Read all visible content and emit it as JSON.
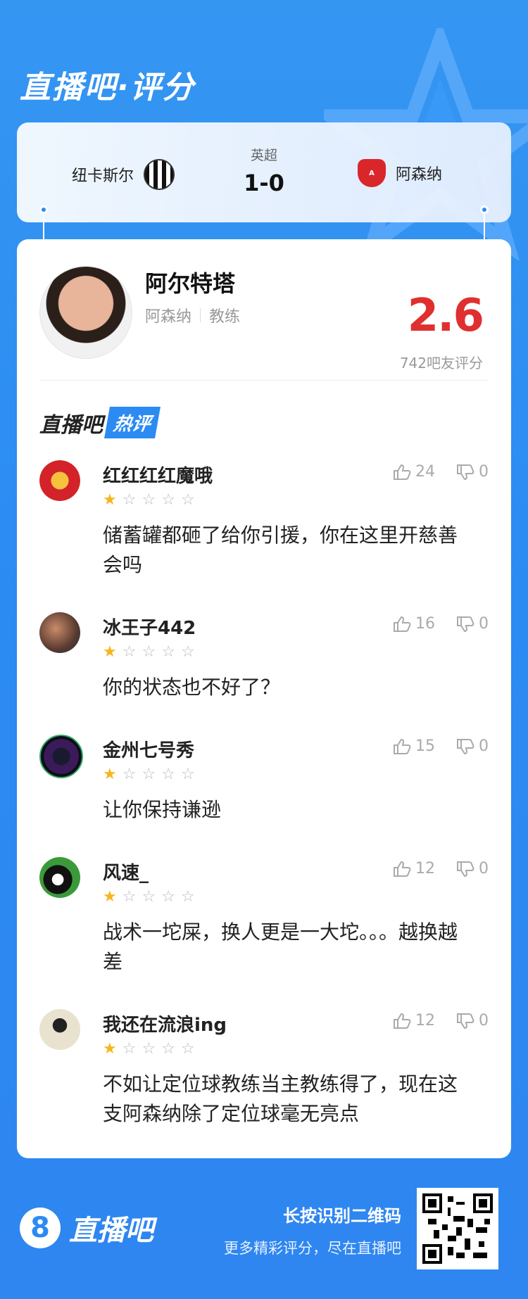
{
  "header": {
    "title": "直播吧·评分"
  },
  "match": {
    "league": "英超",
    "score": "1-0",
    "home_team": "纽卡斯尔",
    "away_team": "阿森纳"
  },
  "coach": {
    "name": "阿尔特塔",
    "team": "阿森纳",
    "role": "教练",
    "rating": "2.6",
    "rating_count": "742吧友评分"
  },
  "hot_section": {
    "label_a": "直播吧",
    "label_b": "热评"
  },
  "comments": [
    {
      "user": "红红红红魔哦",
      "likes": "24",
      "dislikes": "0",
      "stars": 1,
      "text": "储蓄罐都砸了给你引援，你在这里开慈善会吗",
      "avatar_icon": "manchester-united-badge"
    },
    {
      "user": "冰王子442",
      "likes": "16",
      "dislikes": "0",
      "stars": 1,
      "text": "你的状态也不好了？",
      "avatar_icon": "user-avatar"
    },
    {
      "user": "金州七号秀",
      "likes": "15",
      "dislikes": "0",
      "stars": 1,
      "text": "让你保持谦逊",
      "avatar_icon": "user-avatar"
    },
    {
      "user": "风速_",
      "likes": "12",
      "dislikes": "0",
      "stars": 1,
      "text": "战术一坨屎，换人更是一大坨。。。越换越差",
      "avatar_icon": "billiard-ball-avatar"
    },
    {
      "user": "我还在流浪ing",
      "likes": "12",
      "dislikes": "0",
      "stars": 1,
      "text": "不如让定位球教练当主教练得了，现在这支阿森纳除了定位球毫无亮点",
      "avatar_icon": "user-avatar"
    }
  ],
  "footer": {
    "logo_mark": "8",
    "logo_text": "直播吧",
    "line1": "长按识别二维码",
    "line2": "更多精彩评分，尽在直播吧"
  },
  "colors": {
    "accent": "#2b8bf3",
    "rating": "#e02f2f",
    "star": "#f6b51c"
  }
}
